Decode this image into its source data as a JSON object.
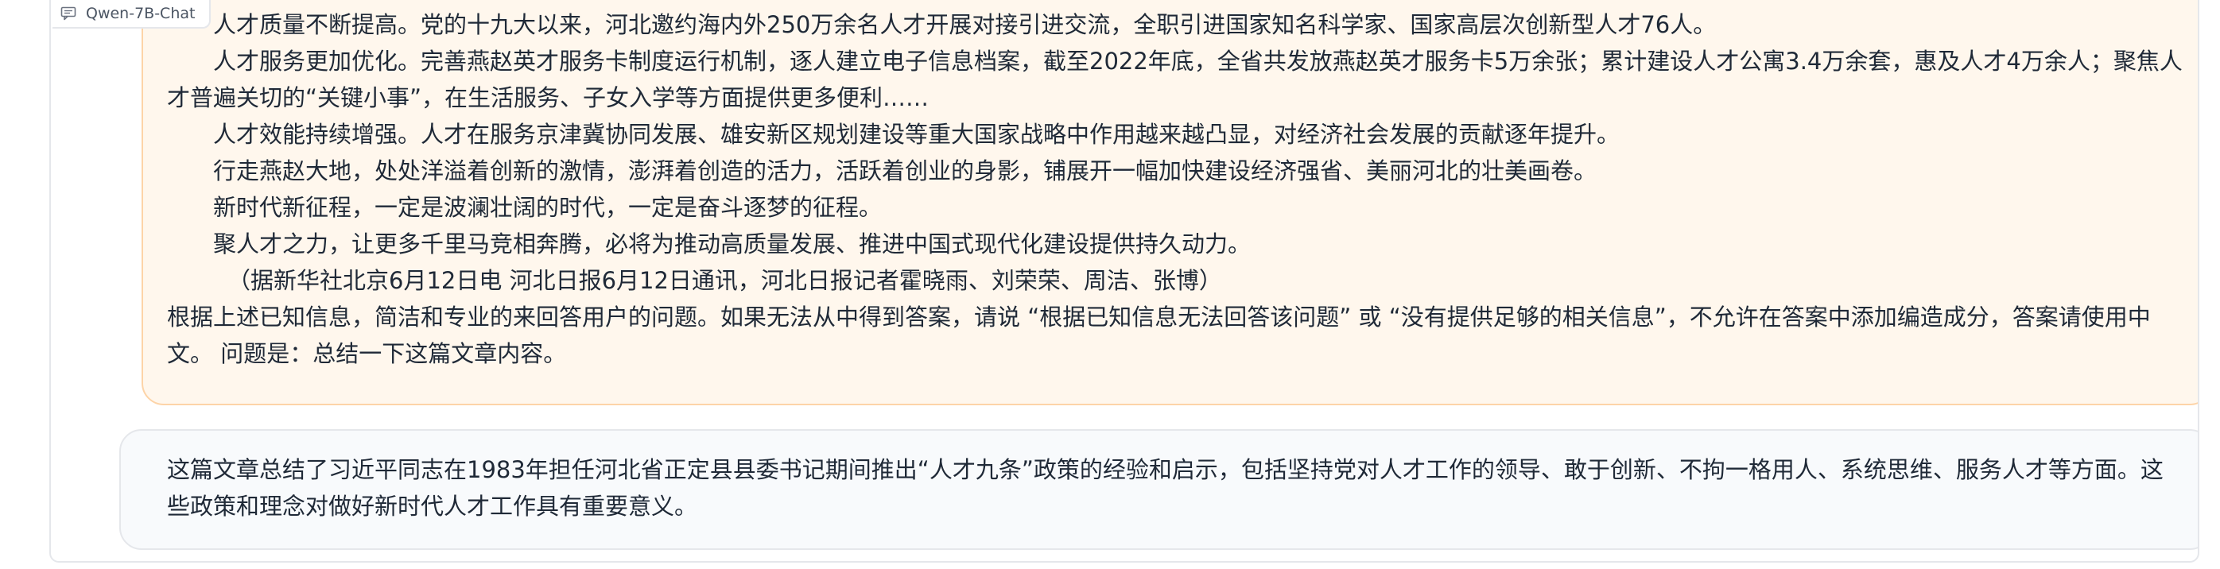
{
  "app": {
    "model_name": "Qwen-7B-Chat",
    "model_icon": "chat-bubble-icon"
  },
  "user_message": {
    "paragraphs": [
      {
        "text": "人才质量不断提高。党的十九大以来，河北邀约海内外250万余名人才开展对接引进交流，全职引进国家知名科学家、国家高层次创新型人才76人。",
        "style": "indent"
      },
      {
        "text": "人才服务更加优化。完善燕赵英才服务卡制度运行机制，逐人建立电子信息档案，截至2022年底，全省共发放燕赵英才服务卡5万余张；累计建设人才公寓3.4万余套，惠及人才4万余人；聚焦人才普遍关切的“关键小事”，在生活服务、子女入学等方面提供更多便利……",
        "style": "indent"
      },
      {
        "text": "人才效能持续增强。人才在服务京津冀协同发展、雄安新区规划建设等重大国家战略中作用越来越凸显，对经济社会发展的贡献逐年提升。",
        "style": "indent"
      },
      {
        "text": "行走燕赵大地，处处洋溢着创新的激情，澎湃着创造的活力，活跃着创业的身影，铺展开一幅加快建设经济强省、美丽河北的壮美画卷。",
        "style": "indent"
      },
      {
        "text": "新时代新征程，一定是波澜壮阔的时代，一定是奋斗逐梦的征程。",
        "style": "indent"
      },
      {
        "text": "聚人才之力，让更多千里马竞相奔腾，必将为推动高质量发展、推进中国式现代化建设提供持久动力。",
        "style": "indent"
      },
      {
        "text": "（据新华社北京6月12日电 河北日报6月12日通讯，河北日报记者霍晓雨、刘荣荣、周洁、张博）",
        "style": "src"
      },
      {
        "text": "根据上述已知信息，简洁和专业的来回答用户的问题。如果无法从中得到答案，请说 “根据已知信息无法回答该问题” 或 “没有提供足够的相关信息”，不允许在答案中添加编造成分，答案请使用中文。 问题是：总结一下这篇文章内容。",
        "style": "plain"
      }
    ]
  },
  "bot_message": {
    "text": "这篇文章总结了习近平同志在1983年担任河北省正定县县委书记期间推出“人才九条”政策的经验和启示，包括坚持党对人才工作的领导、敢于创新、不拘一格用人、系统思维、服务人才等方面。这些政策和理念对做好新时代人才工作具有重要意义。"
  }
}
